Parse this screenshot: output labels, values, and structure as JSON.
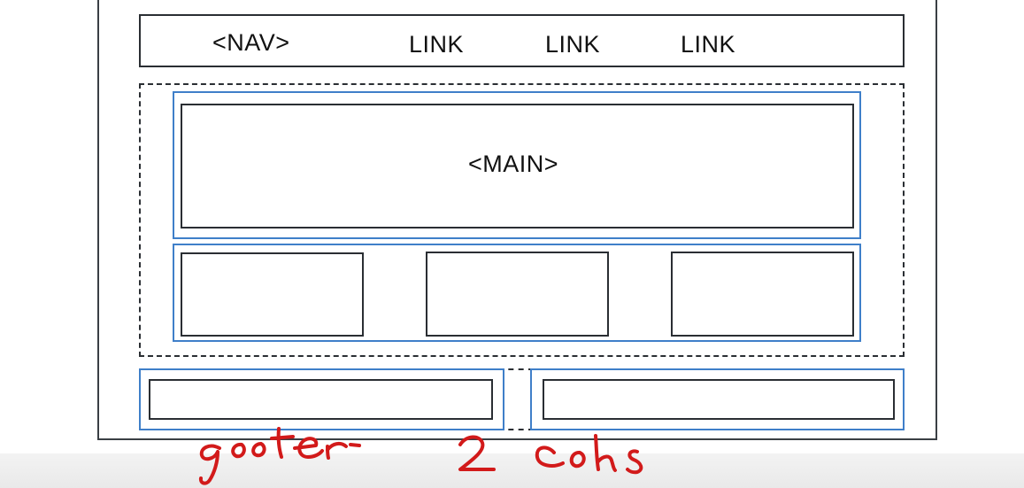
{
  "nav": {
    "label": "<NAV>",
    "links": [
      "LINK",
      "LINK",
      "LINK"
    ]
  },
  "main": {
    "label": "<MAIN>"
  },
  "annotations": {
    "footer_note": "footer",
    "cols_note": "2 cols",
    "ink_color": "#d21a1a"
  },
  "colors": {
    "outline": "#2a2e33",
    "grid_item": "#3f7fc9"
  }
}
